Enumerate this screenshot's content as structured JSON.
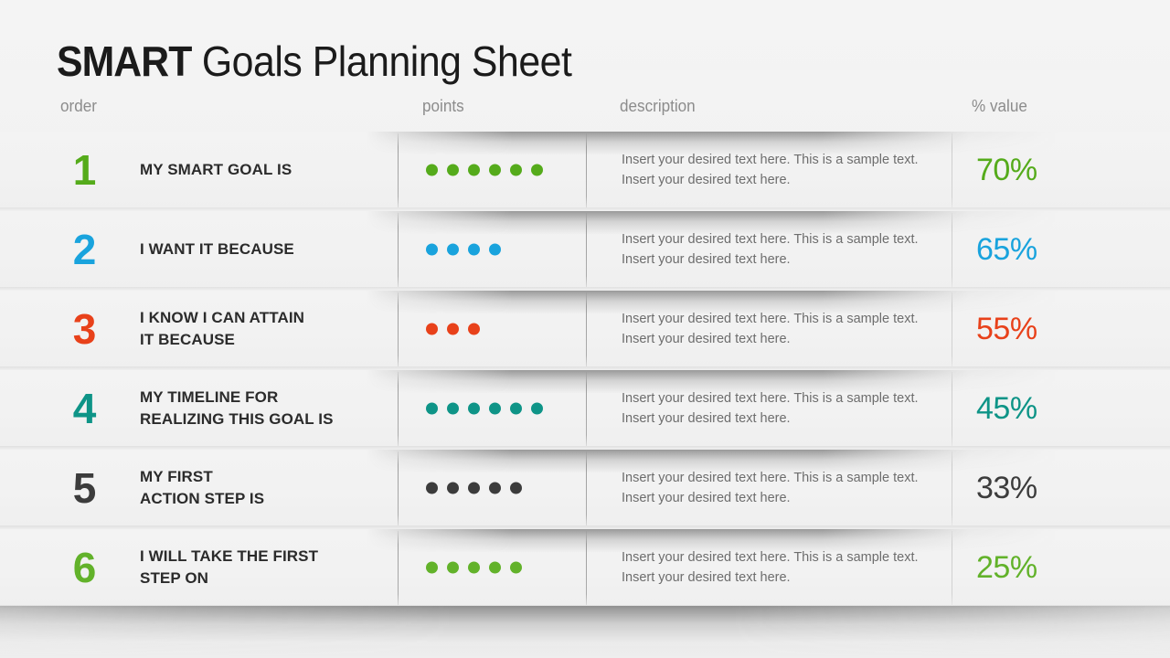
{
  "title": {
    "bold_part": "SMART",
    "rest_part": " Goals Planning Sheet"
  },
  "columns": {
    "order": "order",
    "points": "points",
    "description": "description",
    "value": "% value"
  },
  "colors": {
    "green": "#55ab1b",
    "blue": "#19a3dd",
    "orange": "#e8411a",
    "teal": "#0e9487",
    "gray": "#3c3c3c",
    "green_light": "#62b22a",
    "header_text": "#8c8c8c",
    "label_text": "#2b2b2b",
    "description_text": "#6d6d6d"
  },
  "rows": [
    {
      "order": "1",
      "label_line1": "MY SMART GOAL IS",
      "label_line2": "",
      "points": 6,
      "dot_color": "#55ab1b",
      "number_color": "#55ab1b",
      "description": "Insert your desired text here. This is a sample text. Insert your desired text here.",
      "value": "70%",
      "value_color": "#55ab1b"
    },
    {
      "order": "2",
      "label_line1": "I WANT IT BECAUSE",
      "label_line2": "",
      "points": 4,
      "dot_color": "#19a3dd",
      "number_color": "#19a3dd",
      "description": "Insert your desired text here. This is a sample text. Insert your desired text here.",
      "value": "65%",
      "value_color": "#19a3dd"
    },
    {
      "order": "3",
      "label_line1": "I KNOW I CAN ATTAIN",
      "label_line2": "IT BECAUSE",
      "points": 3,
      "dot_color": "#e8411a",
      "number_color": "#e8411a",
      "description": "Insert your desired text here. This is a sample text. Insert your desired text here.",
      "value": "55%",
      "value_color": "#e8411a"
    },
    {
      "order": "4",
      "label_line1": "MY TIMELINE FOR",
      "label_line2": "REALIZING THIS GOAL IS",
      "points": 6,
      "dot_color": "#0e9487",
      "number_color": "#0e9487",
      "description": "Insert your desired text here. This is a sample text. Insert your desired text here.",
      "value": "45%",
      "value_color": "#0e9487"
    },
    {
      "order": "5",
      "label_line1": "MY FIRST",
      "label_line2": "ACTION STEP IS",
      "points": 5,
      "dot_color": "#3c3c3c",
      "number_color": "#3c3c3c",
      "description": "Insert your desired text here. This is a sample text. Insert your desired text here.",
      "value": "33%",
      "value_color": "#3c3c3c"
    },
    {
      "order": "6",
      "label_line1": "I WILL TAKE THE FIRST",
      "label_line2": "STEP ON",
      "points": 5,
      "dot_color": "#62b22a",
      "number_color": "#62b22a",
      "description": "Insert your desired text here. This is a sample text. Insert your desired text here.",
      "value": "25%",
      "value_color": "#62b22a"
    }
  ]
}
